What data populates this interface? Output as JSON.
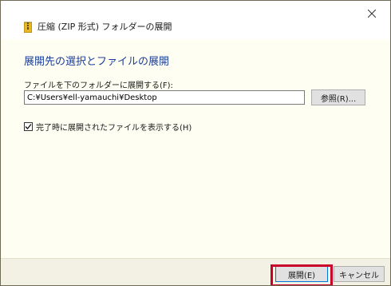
{
  "window": {
    "title": "圧縮 (ZIP 形式) フォルダーの展開"
  },
  "main": {
    "heading": "展開先の選択とファイルの展開",
    "destination_label": "ファイルを下のフォルダーに展開する(F):",
    "destination_path": "C:¥Users¥ell-yamauchi¥Desktop",
    "browse_label": "参照(R)...",
    "show_files_label": "完了時に展開されたファイルを表示する(H)",
    "show_files_checked": true
  },
  "footer": {
    "extract_label": "展開(E)",
    "cancel_label": "キャンセル"
  },
  "colors": {
    "heading": "#1c3e9b",
    "highlight": "#c8002a",
    "zip_icon": "#e8b923"
  }
}
